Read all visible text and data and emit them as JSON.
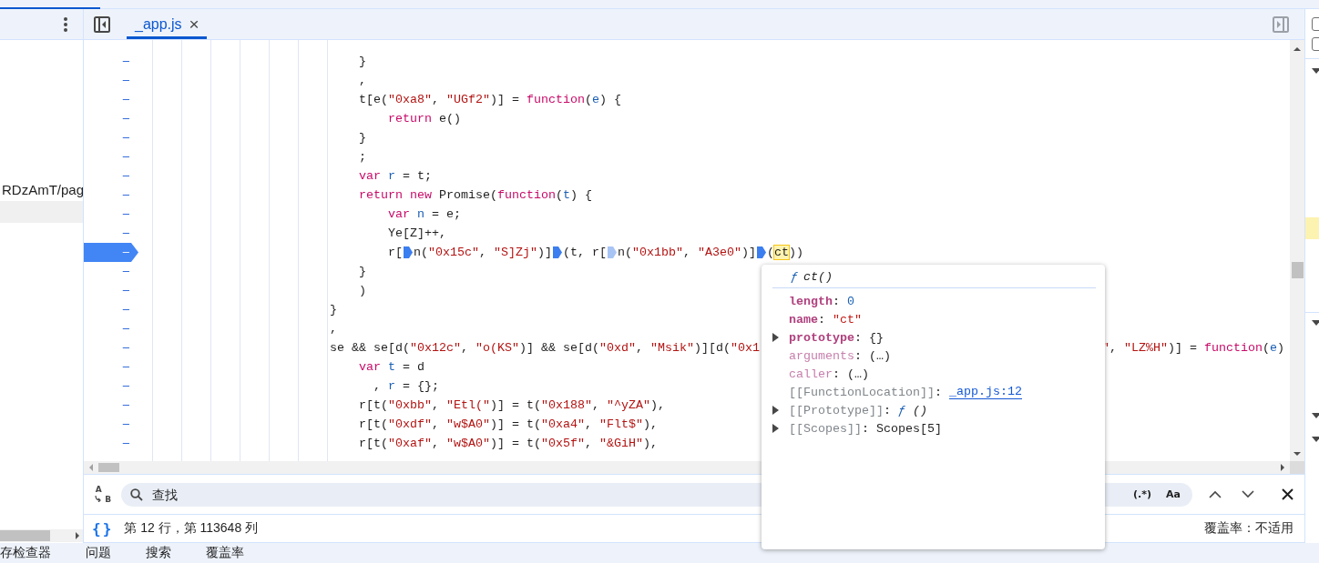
{
  "left_panel": {
    "items": [
      {
        "label": "RDzAmT/pag"
      }
    ]
  },
  "editor": {
    "tabs": [
      {
        "label": "_app.js",
        "selected": true,
        "close": "×"
      }
    ],
    "lines": [
      {
        "gutter": "–",
        "current": false,
        "tokens": [
          {
            "kind": "plain",
            "text": "    }"
          }
        ]
      },
      {
        "gutter": "–",
        "current": false,
        "tokens": [
          {
            "kind": "plain",
            "text": "    ,"
          }
        ]
      },
      {
        "gutter": "–",
        "current": false,
        "tokens": [
          {
            "kind": "plain",
            "text": "    t[e("
          },
          {
            "kind": "str",
            "text": "\"0xa8\""
          },
          {
            "kind": "plain",
            "text": ", "
          },
          {
            "kind": "str",
            "text": "\"UGf2\""
          },
          {
            "kind": "plain",
            "text": ")] = "
          },
          {
            "kind": "kw",
            "text": "function"
          },
          {
            "kind": "plain",
            "text": "("
          },
          {
            "kind": "def",
            "text": "e"
          },
          {
            "kind": "plain",
            "text": ") {"
          }
        ]
      },
      {
        "gutter": "–",
        "current": false,
        "tokens": [
          {
            "kind": "kw",
            "text": "        return"
          },
          {
            "kind": "plain",
            "text": " e()"
          }
        ]
      },
      {
        "gutter": "–",
        "current": false,
        "tokens": [
          {
            "kind": "plain",
            "text": "    }"
          }
        ]
      },
      {
        "gutter": "–",
        "current": false,
        "tokens": [
          {
            "kind": "plain",
            "text": "    ;"
          }
        ]
      },
      {
        "gutter": "–",
        "current": false,
        "tokens": [
          {
            "kind": "kw",
            "text": "    var "
          },
          {
            "kind": "def",
            "text": "r"
          },
          {
            "kind": "plain",
            "text": " = t;"
          }
        ]
      },
      {
        "gutter": "–",
        "current": false,
        "tokens": [
          {
            "kind": "kw",
            "text": "    return new"
          },
          {
            "kind": "plain",
            "text": " Promise("
          },
          {
            "kind": "kw",
            "text": "function"
          },
          {
            "kind": "plain",
            "text": "("
          },
          {
            "kind": "def",
            "text": "t"
          },
          {
            "kind": "plain",
            "text": ") {"
          }
        ]
      },
      {
        "gutter": "–",
        "current": false,
        "tokens": [
          {
            "kind": "kw",
            "text": "        var "
          },
          {
            "kind": "def",
            "text": "n"
          },
          {
            "kind": "plain",
            "text": " = e;"
          }
        ]
      },
      {
        "gutter": "–",
        "current": false,
        "tokens": [
          {
            "kind": "plain",
            "text": "        Ye[Z]++,"
          }
        ]
      },
      {
        "gutter": "–",
        "current": true,
        "tokens": [
          {
            "kind": "plain",
            "text": "        r["
          },
          {
            "kind": "breakpoint",
            "enabled": true
          },
          {
            "kind": "plain",
            "text": "n("
          },
          {
            "kind": "str",
            "text": "\"0x15c\""
          },
          {
            "kind": "plain",
            "text": ", "
          },
          {
            "kind": "str",
            "text": "\"S]Zj\""
          },
          {
            "kind": "plain",
            "text": ")]"
          },
          {
            "kind": "breakpoint",
            "enabled": true
          },
          {
            "kind": "plain",
            "text": "(t, r["
          },
          {
            "kind": "breakpoint",
            "enabled": false
          },
          {
            "kind": "plain",
            "text": "n("
          },
          {
            "kind": "str",
            "text": "\"0x1bb\""
          },
          {
            "kind": "plain",
            "text": ", "
          },
          {
            "kind": "str",
            "text": "\"A3e0\""
          },
          {
            "kind": "plain",
            "text": ")]"
          },
          {
            "kind": "breakpoint",
            "enabled": true
          },
          {
            "kind": "plain",
            "text": "("
          },
          {
            "kind": "hover",
            "text": "ct"
          },
          {
            "kind": "plain",
            "text": "))"
          }
        ]
      },
      {
        "gutter": "–",
        "current": false,
        "tokens": [
          {
            "kind": "plain",
            "text": "    }"
          }
        ]
      },
      {
        "gutter": "–",
        "current": false,
        "tokens": [
          {
            "kind": "plain",
            "text": "    )"
          }
        ]
      },
      {
        "gutter": "–",
        "current": false,
        "tokens": [
          {
            "kind": "plain",
            "text": "}"
          }
        ]
      },
      {
        "gutter": "–",
        "current": false,
        "tokens": [
          {
            "kind": "plain",
            "text": ","
          }
        ]
      },
      {
        "gutter": "–",
        "current": false,
        "tokens": [
          {
            "kind": "plain",
            "text": "se && se[d("
          },
          {
            "kind": "str",
            "text": "\"0x12c\""
          },
          {
            "kind": "plain",
            "text": ", "
          },
          {
            "kind": "str",
            "text": "\"o(KS\""
          },
          {
            "kind": "plain",
            "text": ")] && se[d("
          },
          {
            "kind": "str",
            "text": "\"0xd\""
          },
          {
            "kind": "plain",
            "text": ", "
          },
          {
            "kind": "str",
            "text": "\"Msik\""
          },
          {
            "kind": "plain",
            "text": ")][d("
          },
          {
            "kind": "str",
            "text": "\"0x1"
          },
          {
            "kind": "gap"
          },
          {
            "kind": "str",
            "text": "\""
          },
          {
            "kind": "plain",
            "text": ", "
          },
          {
            "kind": "str",
            "text": "\"LZ%H\""
          },
          {
            "kind": "plain",
            "text": ")] = "
          },
          {
            "kind": "kw",
            "text": "function"
          },
          {
            "kind": "plain",
            "text": "("
          },
          {
            "kind": "def",
            "text": "e"
          },
          {
            "kind": "plain",
            "text": ")"
          }
        ]
      },
      {
        "gutter": "–",
        "current": false,
        "tokens": [
          {
            "kind": "kw",
            "text": "    var "
          },
          {
            "kind": "def",
            "text": "t"
          },
          {
            "kind": "plain",
            "text": " = d"
          }
        ]
      },
      {
        "gutter": "–",
        "current": false,
        "tokens": [
          {
            "kind": "plain",
            "text": "      , "
          },
          {
            "kind": "def",
            "text": "r"
          },
          {
            "kind": "plain",
            "text": " = {};"
          }
        ]
      },
      {
        "gutter": "–",
        "current": false,
        "tokens": [
          {
            "kind": "plain",
            "text": "    r[t("
          },
          {
            "kind": "str",
            "text": "\"0xbb\""
          },
          {
            "kind": "plain",
            "text": ", "
          },
          {
            "kind": "str",
            "text": "\"Etl(\""
          },
          {
            "kind": "plain",
            "text": ")] = t("
          },
          {
            "kind": "str",
            "text": "\"0x188\""
          },
          {
            "kind": "plain",
            "text": ", "
          },
          {
            "kind": "str",
            "text": "\"^yZA\""
          },
          {
            "kind": "plain",
            "text": "),"
          }
        ]
      },
      {
        "gutter": "–",
        "current": false,
        "tokens": [
          {
            "kind": "plain",
            "text": "    r[t("
          },
          {
            "kind": "str",
            "text": "\"0xdf\""
          },
          {
            "kind": "plain",
            "text": ", "
          },
          {
            "kind": "str",
            "text": "\"w$A0\""
          },
          {
            "kind": "plain",
            "text": ")] = t("
          },
          {
            "kind": "str",
            "text": "\"0xa4\""
          },
          {
            "kind": "plain",
            "text": ", "
          },
          {
            "kind": "str",
            "text": "\"Flt$\""
          },
          {
            "kind": "plain",
            "text": "),"
          }
        ]
      },
      {
        "gutter": "–",
        "current": false,
        "tokens": [
          {
            "kind": "plain",
            "text": "    r[t("
          },
          {
            "kind": "str",
            "text": "\"0xaf\""
          },
          {
            "kind": "plain",
            "text": ", "
          },
          {
            "kind": "str",
            "text": "\"w$A0\""
          },
          {
            "kind": "plain",
            "text": ")] = t("
          },
          {
            "kind": "str",
            "text": "\"0x5f\""
          },
          {
            "kind": "plain",
            "text": ", "
          },
          {
            "kind": "str",
            "text": "\"&GiH\""
          },
          {
            "kind": "plain",
            "text": "),"
          }
        ]
      }
    ]
  },
  "popover": {
    "prefix": "ƒ",
    "title": "ct()",
    "rows": [
      {
        "key": "length",
        "sep": ":",
        "value": "0",
        "kind": "number",
        "enumerable": true,
        "internal": false,
        "expandable": false
      },
      {
        "key": "name",
        "sep": ":",
        "value": "\"ct\"",
        "kind": "string",
        "enumerable": true,
        "internal": false,
        "expandable": false
      },
      {
        "key": "prototype",
        "sep": ":",
        "value": "{}",
        "kind": "plain",
        "enumerable": true,
        "internal": false,
        "expandable": true
      },
      {
        "key": "arguments",
        "sep": ":",
        "value": "(…)",
        "kind": "plain",
        "enumerable": false,
        "internal": false,
        "expandable": false
      },
      {
        "key": "caller",
        "sep": ":",
        "value": "(…)",
        "kind": "plain",
        "enumerable": false,
        "internal": false,
        "expandable": false
      },
      {
        "key": "[[FunctionLocation]]",
        "sep": ":",
        "value": "_app.js:12",
        "kind": "link",
        "enumerable": false,
        "internal": true,
        "expandable": false
      },
      {
        "key": "[[Prototype]]",
        "sep": ":",
        "prefix": "ƒ",
        "value": "()",
        "kind": "function",
        "enumerable": false,
        "internal": true,
        "expandable": true
      },
      {
        "key": "[[Scopes]]",
        "sep": ":",
        "value": "Scopes[5]",
        "kind": "plain",
        "enumerable": false,
        "internal": true,
        "expandable": true
      }
    ]
  },
  "search": {
    "toggle_top": "A",
    "toggle_bottom": "B",
    "placeholder": "查找",
    "regex": "(.*)",
    "case": "Aa"
  },
  "status_bar": {
    "format": "{}",
    "position": "第 12 行，第 113648 列",
    "coverage": "覆盖率：不适用"
  },
  "right_panel": {
    "checkboxes": [
      {
        "checked": false
      },
      {
        "checked": false
      }
    ]
  },
  "drawer_tabs": [
    {
      "label": "存检查器",
      "selected": false
    },
    {
      "label": "问题",
      "selected": false
    },
    {
      "label": "搜索",
      "selected": false
    },
    {
      "label": "覆盖率",
      "selected": false
    }
  ]
}
